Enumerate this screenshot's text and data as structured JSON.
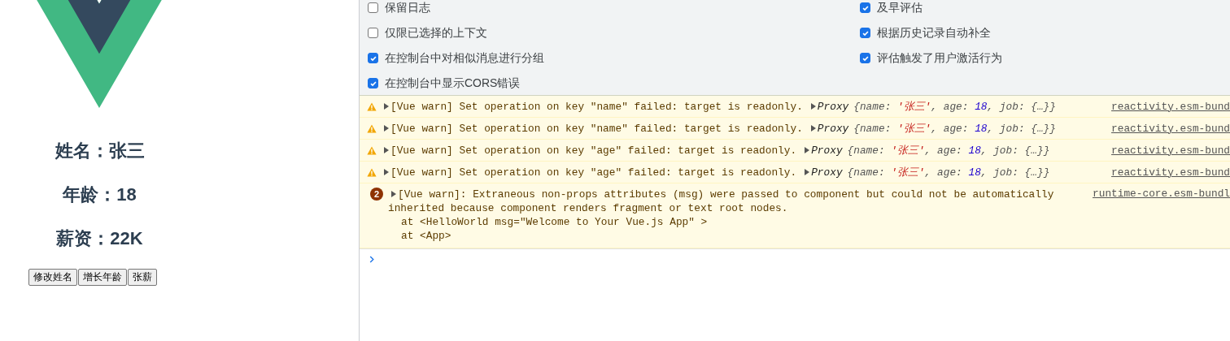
{
  "app": {
    "lines": [
      "姓名：张三",
      "年龄：18",
      "薪资：22K"
    ],
    "buttons": [
      "修改姓名",
      "增长年龄",
      "张薪"
    ]
  },
  "settings": {
    "left": [
      {
        "label": "保留日志",
        "checked": false
      },
      {
        "label": "仅限已选择的上下文",
        "checked": false
      },
      {
        "label": "在控制台中对相似消息进行分组",
        "checked": true
      },
      {
        "label": "在控制台中显示CORS错误",
        "checked": true
      }
    ],
    "right": [
      {
        "label": "及早评估",
        "checked": true
      },
      {
        "label": "根据历史记录自动补全",
        "checked": true
      },
      {
        "label": "评估触发了用户激活行为",
        "checked": true
      }
    ]
  },
  "console": [
    {
      "kind": "warning",
      "text": "[Vue warn] Set operation on key \"name\" failed: target is readonly.",
      "object": [
        {
          "kind": "label",
          "text": "Proxy"
        },
        {
          "kind": "punct",
          "text": "{"
        },
        {
          "kind": "key",
          "text": "name: "
        },
        {
          "kind": "string",
          "text": "'张三'"
        },
        {
          "kind": "punct",
          "text": ", "
        },
        {
          "kind": "key",
          "text": "age: "
        },
        {
          "kind": "number",
          "text": "18"
        },
        {
          "kind": "punct",
          "text": ", "
        },
        {
          "kind": "key",
          "text": "job: "
        },
        {
          "kind": "punct",
          "text": "{…}}"
        }
      ],
      "source": "reactivity.esm-bund"
    },
    {
      "kind": "warning",
      "text": "[Vue warn] Set operation on key \"name\" failed: target is readonly.",
      "object": [
        {
          "kind": "label",
          "text": "Proxy"
        },
        {
          "kind": "punct",
          "text": "{"
        },
        {
          "kind": "key",
          "text": "name: "
        },
        {
          "kind": "string",
          "text": "'张三'"
        },
        {
          "kind": "punct",
          "text": ", "
        },
        {
          "kind": "key",
          "text": "age: "
        },
        {
          "kind": "number",
          "text": "18"
        },
        {
          "kind": "punct",
          "text": ", "
        },
        {
          "kind": "key",
          "text": "job: "
        },
        {
          "kind": "punct",
          "text": "{…}}"
        }
      ],
      "source": "reactivity.esm-bund"
    },
    {
      "kind": "warning",
      "text": "[Vue warn] Set operation on key \"age\" failed: target is readonly.",
      "object": [
        {
          "kind": "label",
          "text": "Proxy"
        },
        {
          "kind": "punct",
          "text": "{"
        },
        {
          "kind": "key",
          "text": "name: "
        },
        {
          "kind": "string",
          "text": "'张三'"
        },
        {
          "kind": "punct",
          "text": ", "
        },
        {
          "kind": "key",
          "text": "age: "
        },
        {
          "kind": "number",
          "text": "18"
        },
        {
          "kind": "punct",
          "text": ", "
        },
        {
          "kind": "key",
          "text": "job: "
        },
        {
          "kind": "punct",
          "text": "{…}}"
        }
      ],
      "source": "reactivity.esm-bund"
    },
    {
      "kind": "warning",
      "text": "[Vue warn] Set operation on key \"age\" failed: target is readonly.",
      "object": [
        {
          "kind": "label",
          "text": "Proxy"
        },
        {
          "kind": "punct",
          "text": "{"
        },
        {
          "kind": "key",
          "text": "name: "
        },
        {
          "kind": "string",
          "text": "'张三'"
        },
        {
          "kind": "punct",
          "text": ", "
        },
        {
          "kind": "key",
          "text": "age: "
        },
        {
          "kind": "number",
          "text": "18"
        },
        {
          "kind": "punct",
          "text": ", "
        },
        {
          "kind": "key",
          "text": "job: "
        },
        {
          "kind": "punct",
          "text": "{…}}"
        }
      ],
      "source": "reactivity.esm-bund"
    },
    {
      "kind": "group",
      "count": "2",
      "text": "[Vue warn]: Extraneous non-props attributes (msg) were passed to component but could not be automatically inherited because component renders fragment or text root nodes.",
      "stack": [
        "at <HelloWorld msg=\"Welcome to Your Vue.js App\" >",
        "at <App>"
      ],
      "source": "runtime-core.esm-bundl"
    }
  ]
}
